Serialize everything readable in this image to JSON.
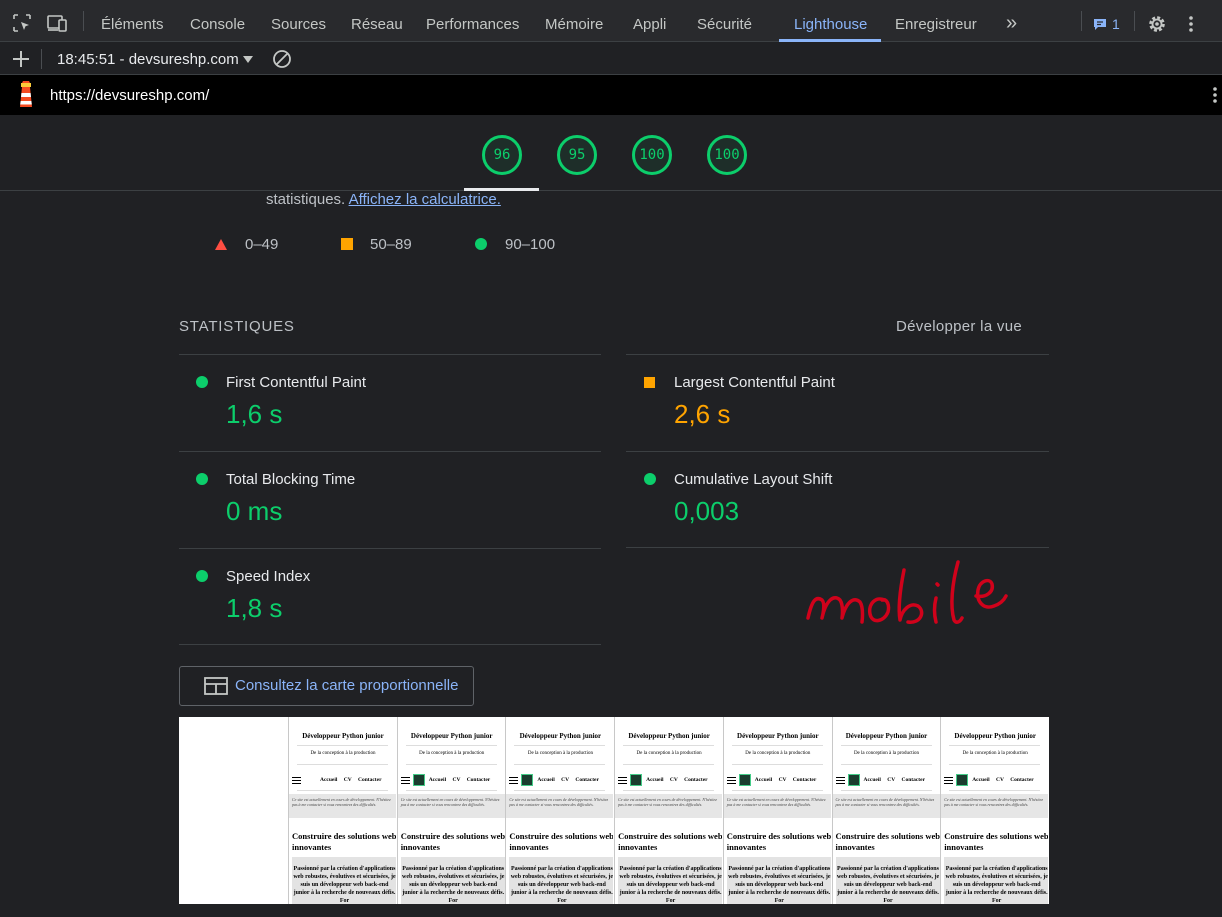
{
  "devtools": {
    "tabs": [
      "Éléments",
      "Console",
      "Sources",
      "Réseau",
      "Performances",
      "Mémoire",
      "Appli",
      "Sécurité",
      "Lighthouse",
      "Enregistreur"
    ],
    "active_tab": "Lighthouse",
    "more_tabs_glyph": "»",
    "issues_count": "1",
    "report_selector": "18:45:51 - devsureshp.com",
    "url": "https://devsureshp.com/"
  },
  "gauges": [
    {
      "score": "96",
      "color": "#0cce6b"
    },
    {
      "score": "95",
      "color": "#0cce6b"
    },
    {
      "score": "100",
      "color": "#0cce6b"
    },
    {
      "score": "100",
      "color": "#0cce6b"
    }
  ],
  "intro": {
    "text": "statistiques.",
    "link": "Affichez la calculatrice."
  },
  "legend": [
    {
      "label": "0–49",
      "shape": "triangle",
      "color": "#ff4e42"
    },
    {
      "label": "50–89",
      "shape": "square",
      "color": "#ffa400"
    },
    {
      "label": "90–100",
      "shape": "circle",
      "color": "#0cce6b"
    }
  ],
  "metrics_section": {
    "title": "STATISTIQUES",
    "toggle": "Développer la vue",
    "metrics": [
      {
        "name": "First Contentful Paint",
        "value": "1,6 s",
        "rating": "pass"
      },
      {
        "name": "Largest Contentful Paint",
        "value": "2,6 s",
        "rating": "average"
      },
      {
        "name": "Total Blocking Time",
        "value": "0 ms",
        "rating": "pass"
      },
      {
        "name": "Cumulative Layout Shift",
        "value": "0,003",
        "rating": "pass"
      },
      {
        "name": "Speed Index",
        "value": "1,8 s",
        "rating": "pass"
      }
    ]
  },
  "annotation": {
    "text": "mobile",
    "color": "#d0021b"
  },
  "treemap_button": {
    "label": "Consultez la carte proportionnelle"
  },
  "filmstrip": {
    "title": "Développeur Python junior",
    "subtitle": "De la conception à la production",
    "nav": "Accueil CV Contacter",
    "banner": "Ce site est actuellement en cours de développement. N'hésitez pas à me contacter si vous rencontrez des difficultés.",
    "heading": "Construire des solutions web innovantes",
    "box": "Passionné par la création d'applications web robustes, évolutives et sécurisées, je suis un développeur web back-end junior à la recherche de nouveaux défis. For"
  },
  "icons": {
    "inspect": "inspect-element-icon",
    "device": "device-toolbar-icon",
    "chevron": "more-tabs-icon",
    "issues": "issues-icon",
    "settings": "gear-icon",
    "menu": "kebab-menu-icon",
    "add": "plus-icon",
    "dropdown": "caret-down-icon",
    "clear": "clear-icon",
    "lighthouse": "lighthouse-logo",
    "treemap": "treemap-icon"
  }
}
